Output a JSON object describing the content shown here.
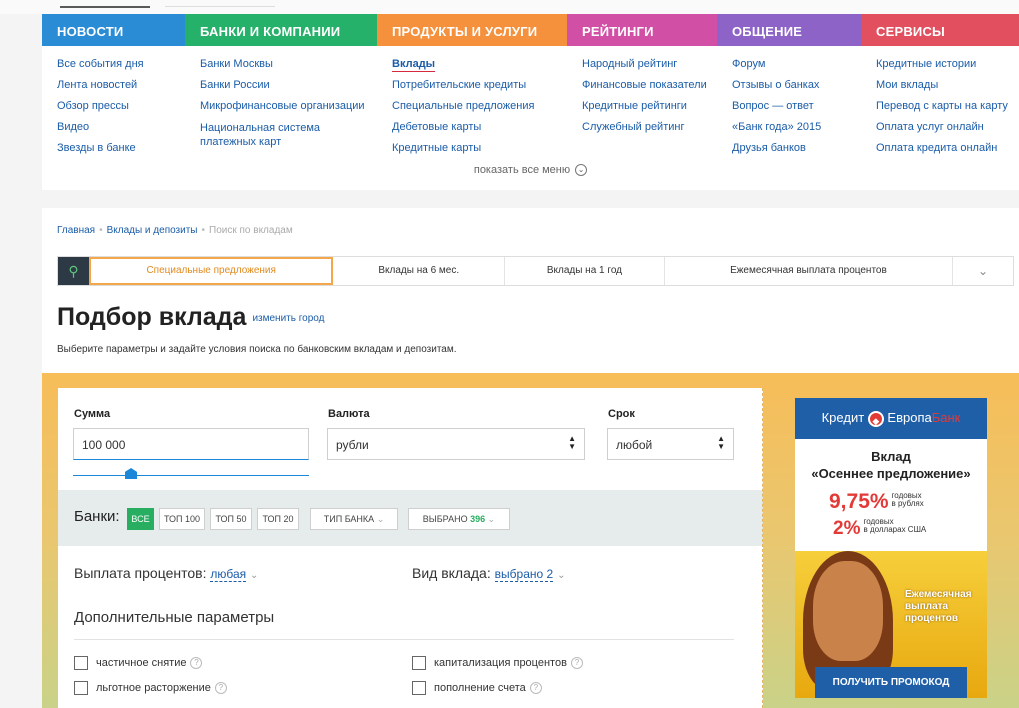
{
  "colors": {
    "news": "#2b8cd6",
    "banks": "#26b16a",
    "products": "#f5903c",
    "ratings": "#d14fa5",
    "community": "#8d63c8",
    "services": "#e24f5f"
  },
  "menu": {
    "headers": [
      "НОВОСТИ",
      "БАНКИ И КОМПАНИИ",
      "ПРОДУКТЫ И УСЛУГИ",
      "РЕЙТИНГИ",
      "ОБЩЕНИЕ",
      "СЕРВИСЫ"
    ],
    "news": [
      "Все события дня",
      "Лента новостей",
      "Обзор прессы",
      "Видео",
      "Звезды в банке"
    ],
    "banks": [
      "Банки Москвы",
      "Банки России",
      "Микрофинансовые организации",
      "Национальная система платежных карт"
    ],
    "products": [
      "Вклады",
      "Потребительские кредиты",
      "Специальные предложения",
      "Дебетовые карты",
      "Кредитные карты"
    ],
    "ratings": [
      "Народный рейтинг",
      "Финансовые показатели",
      "Кредитные рейтинги",
      "Служебный рейтинг"
    ],
    "community": [
      "Форум",
      "Отзывы о банках",
      "Вопрос — ответ",
      "«Банк года» 2015",
      "Друзья банков"
    ],
    "services": [
      "Кредитные истории",
      "Мои вклады",
      "Перевод с карты на карту",
      "Оплата услуг онлайн",
      "Оплата кредита онлайн"
    ],
    "show_all": "показать все меню"
  },
  "breadcrumb": [
    "Главная",
    "Вклады и депозиты",
    "Поиск по вкладам"
  ],
  "tabs": [
    "Специальные предложения",
    "Вклады на 6 мес.",
    "Вклады на 1 год",
    "Ежемесячная выплата процентов"
  ],
  "title": "Подбор вклада",
  "change_city": "изменить город",
  "subtitle": "Выберите параметры и задайте условия поиска по банковским вкладам и депозитам.",
  "form": {
    "sum_label": "Сумма",
    "sum_value": "100 000",
    "currency_label": "Валюта",
    "currency_value": "рубли",
    "term_label": "Срок",
    "term_value": "любой",
    "banks_label": "Банки:",
    "pills": [
      "ВСЕ",
      "ТОП 100",
      "ТОП 50",
      "ТОП 20",
      "ТИП БАНКА",
      "ВЫБРАНО"
    ],
    "selected_count": "396",
    "payout_label": "Выплата процентов:",
    "payout_value": "любая",
    "type_label": "Вид вклада:",
    "type_value": "выбрано 2",
    "additional": "Дополнительные параметры",
    "checkboxes": [
      "частичное снятие",
      "льготное расторжение",
      "капитализация процентов",
      "пополнение счета"
    ]
  },
  "ad": {
    "brand_a": "Кредит",
    "brand_b": "Европа",
    "brand_c": "Банк",
    "heading_1": "Вклад",
    "heading_2": "«Осеннее предложение»",
    "rate_1": "9,75%",
    "rate_1_note_a": "годовых",
    "rate_1_note_b": "в рублях",
    "rate_2": "2%",
    "rate_2_note_a": "годовых",
    "rate_2_note_b": "в долларах США",
    "photo_text": "Ежемесячная выплата процентов",
    "cta": "ПОЛУЧИТЬ ПРОМОКОД"
  }
}
